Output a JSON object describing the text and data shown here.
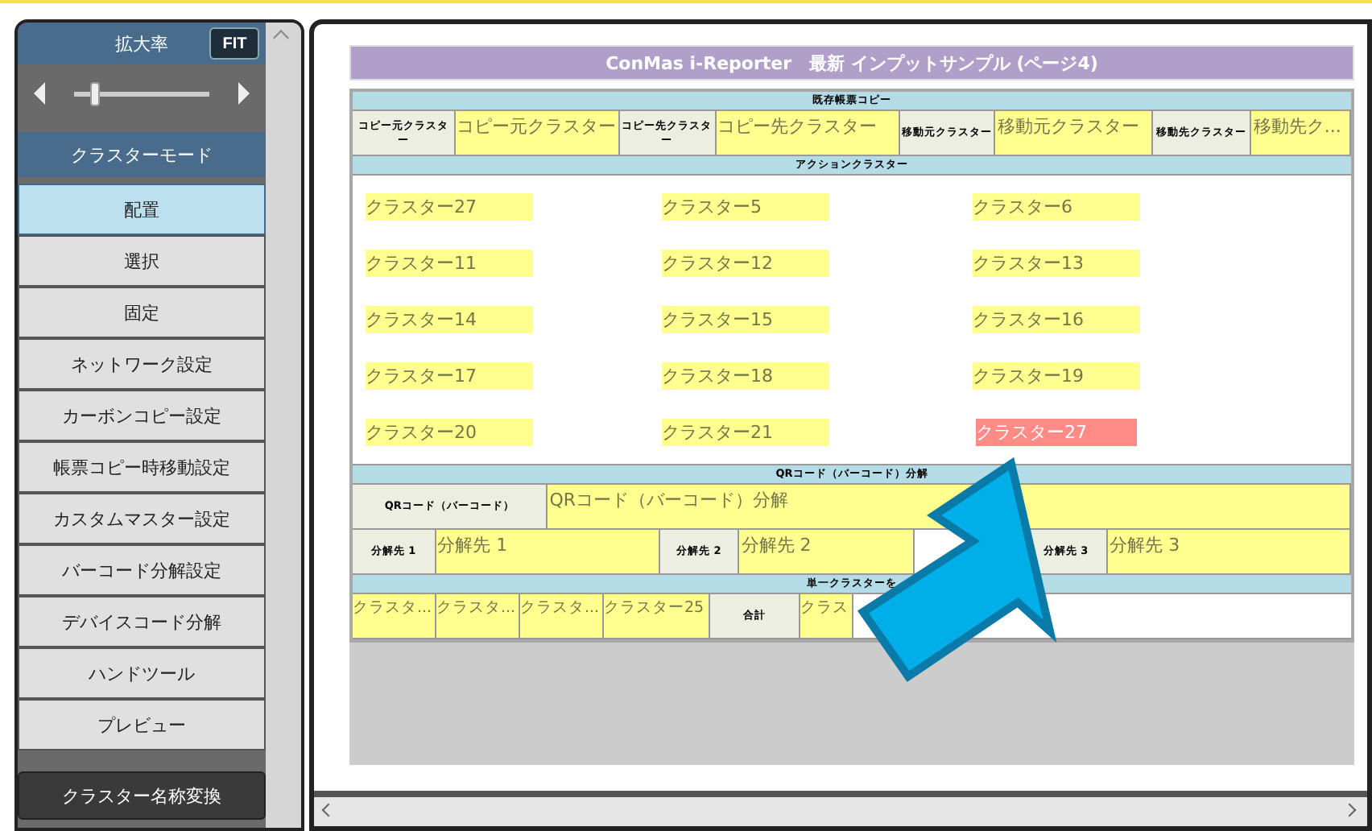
{
  "sidebar": {
    "zoom_header": {
      "label": "拡大率",
      "fit_button": "FIT"
    },
    "zoom_slider": {
      "level": 0.15
    },
    "mode_header": "クラスターモード",
    "mode_buttons": [
      {
        "label": "配置",
        "selected": true
      },
      {
        "label": "選択",
        "selected": false
      },
      {
        "label": "固定",
        "selected": false
      },
      {
        "label": "ネットワーク設定",
        "selected": false
      },
      {
        "label": "カーボンコピー設定",
        "selected": false
      },
      {
        "label": "帳票コピー時移動設定",
        "selected": false
      },
      {
        "label": "カスタムマスター設定",
        "selected": false
      },
      {
        "label": "バーコード分解設定",
        "selected": false
      },
      {
        "label": "デバイスコード分解",
        "selected": false
      },
      {
        "label": "ハンドツール",
        "selected": false
      },
      {
        "label": "プレビュー",
        "selected": false
      }
    ],
    "rename_button": "クラスター名称変換"
  },
  "form": {
    "title": "ConMas i-Reporter　最新 インプットサンプル (ページ4)",
    "sections": [
      {
        "kind": "rows",
        "header": "既存帳票コピー",
        "rows": [
          [
            {
              "kind": "label",
              "text": "コピー元クラスター"
            },
            {
              "kind": "field",
              "text": "コピー元クラスター"
            },
            {
              "kind": "label",
              "text": "コピー先クラスター"
            },
            {
              "kind": "field",
              "text": "コピー先クラスター"
            },
            {
              "kind": "label",
              "text": "移動元クラスター"
            },
            {
              "kind": "field",
              "text": "移動元クラスター"
            },
            {
              "kind": "label",
              "text": "移動先クラスター"
            },
            {
              "kind": "field",
              "text": "移動先ク..."
            }
          ]
        ]
      },
      {
        "kind": "grid",
        "header": "アクションクラスター",
        "items": [
          {
            "text": "クラスター27",
            "selected": false
          },
          {
            "text": "クラスター5",
            "selected": false
          },
          {
            "text": "クラスター6",
            "selected": false
          },
          {
            "text": "クラスター11",
            "selected": false
          },
          {
            "text": "クラスター12",
            "selected": false
          },
          {
            "text": "クラスター13",
            "selected": false
          },
          {
            "text": "クラスター14",
            "selected": false
          },
          {
            "text": "クラスター15",
            "selected": false
          },
          {
            "text": "クラスター16",
            "selected": false
          },
          {
            "text": "クラスター17",
            "selected": false
          },
          {
            "text": "クラスター18",
            "selected": false
          },
          {
            "text": "クラスター19",
            "selected": false
          },
          {
            "text": "クラスター20",
            "selected": false
          },
          {
            "text": "クラスター21",
            "selected": false
          },
          {
            "text": "クラスター27",
            "selected": true
          }
        ]
      },
      {
        "kind": "rows",
        "header": "QRコード（バーコード）分解",
        "rows": [
          [
            {
              "kind": "label",
              "text": "QRコード（バーコード）"
            },
            {
              "kind": "field",
              "text": "QRコード（バーコード）分解"
            }
          ]
        ]
      },
      {
        "kind": "rows",
        "rows": [
          [
            {
              "kind": "label",
              "text": "分解先 1"
            },
            {
              "kind": "field",
              "text": "分解先 1"
            },
            {
              "kind": "label",
              "text": "分解先 2"
            },
            {
              "kind": "field",
              "text": "分解先 2"
            },
            {
              "kind": "label",
              "text": "分解先 3"
            },
            {
              "kind": "field",
              "text": "分解先 3"
            }
          ]
        ]
      },
      {
        "kind": "rows",
        "header": "単一クラスターを",
        "rows": [
          [
            {
              "kind": "field",
              "text": "クラスタ..."
            },
            {
              "kind": "field",
              "text": "クラスタ..."
            },
            {
              "kind": "field",
              "text": "クラスタ..."
            },
            {
              "kind": "field",
              "text": "クラスター25"
            },
            {
              "kind": "label",
              "text": "合計"
            },
            {
              "kind": "field",
              "text": "クラス"
            }
          ]
        ]
      }
    ]
  }
}
